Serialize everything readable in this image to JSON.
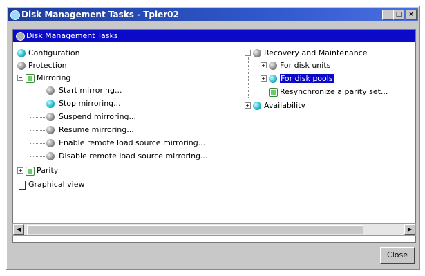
{
  "window": {
    "title": "Disk Management Tasks - Tpler02"
  },
  "panel": {
    "header": "Disk Management Tasks"
  },
  "tree": {
    "left": {
      "configuration": "Configuration",
      "protection": "Protection",
      "mirroring": "Mirroring",
      "mirroring_children": [
        "Start mirroring...",
        "Stop mirroring...",
        "Suspend mirroring...",
        "Resume mirroring...",
        "Enable remote load source mirroring...",
        "Disable remote load source mirroring..."
      ],
      "parity": "Parity",
      "graphical_view": "Graphical view"
    },
    "right": {
      "recovery": "Recovery and Maintenance",
      "for_disk_units": "For disk units",
      "for_disk_pools": "For disk pools",
      "resync": "Resynchronize a parity set...",
      "availability": "Availability"
    }
  },
  "buttons": {
    "close": "Close"
  }
}
